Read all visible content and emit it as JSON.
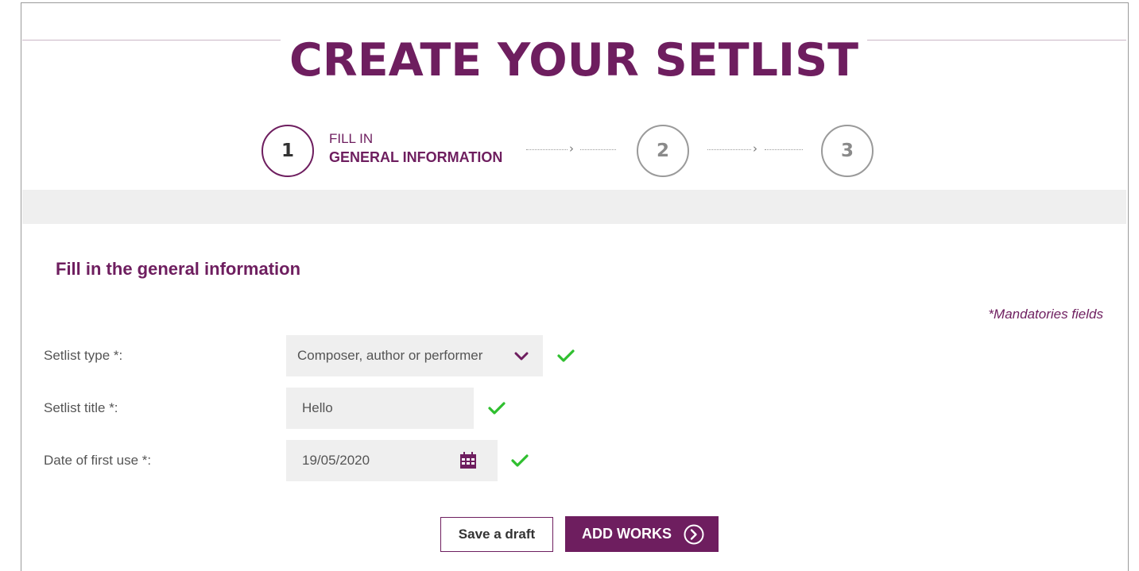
{
  "page": {
    "title": "CREATE YOUR SETLIST"
  },
  "stepper": {
    "step1_number": "1",
    "step1_line1": "FILL IN",
    "step1_line2": "GENERAL INFORMATION",
    "step2_number": "2",
    "step3_number": "3"
  },
  "form": {
    "section_title": "Fill in the general information",
    "mandatory_note": "*Mandatories fields",
    "setlist_type": {
      "label": "Setlist type *:",
      "value": "Composer, author or performer"
    },
    "setlist_title": {
      "label": "Setlist title *:",
      "value": "Hello"
    },
    "date_first_use": {
      "label": "Date of first use *:",
      "value": "19/05/2020"
    }
  },
  "actions": {
    "save_draft_label": "Save a draft",
    "add_works_label": "ADD WORKS"
  },
  "colors": {
    "brand": "#6e1e5f",
    "check": "#2fbf2f",
    "field_bg": "#efefef"
  },
  "icons": {
    "dropdown": "chevron-down-icon",
    "calendar": "calendar-icon",
    "valid": "check-icon",
    "next": "arrow-right-circle-icon"
  }
}
